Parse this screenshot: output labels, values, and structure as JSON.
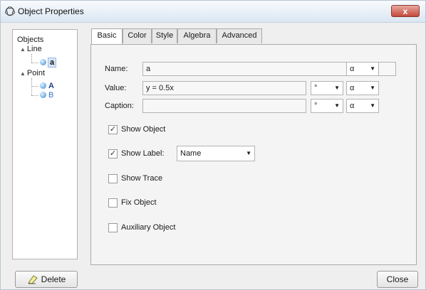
{
  "window": {
    "title": "Object Properties",
    "close_glyph": "x"
  },
  "tree": {
    "root": "Objects",
    "groups": [
      {
        "label": "Line",
        "items": [
          "a"
        ]
      },
      {
        "label": "Point",
        "items": [
          "A",
          "B"
        ]
      }
    ],
    "expanded_glyph": "▲"
  },
  "tabs": [
    {
      "label": "Basic"
    },
    {
      "label": "Color"
    },
    {
      "label": "Style"
    },
    {
      "label": "Algebra"
    },
    {
      "label": "Advanced"
    }
  ],
  "fields": {
    "name_label": "Name:",
    "name_value": "a",
    "value_label": "Value:",
    "value_value": "y = 0.5x",
    "caption_label": "Caption:",
    "caption_value": "",
    "alpha_symbol": "α",
    "degree_symbol": "°"
  },
  "checkboxes": {
    "show_object": "Show Object",
    "show_label": "Show Label:",
    "show_trace": "Show Trace",
    "fix_object": "Fix Object",
    "auxiliary_object": "Auxiliary Object",
    "checked_glyph": "✓"
  },
  "label_dropdown": {
    "selected": "Name"
  },
  "buttons": {
    "delete": "Delete",
    "close": "Close"
  },
  "icons": {
    "arrow": "▼"
  },
  "colors": {
    "tree_item": "#1f3f8f"
  }
}
